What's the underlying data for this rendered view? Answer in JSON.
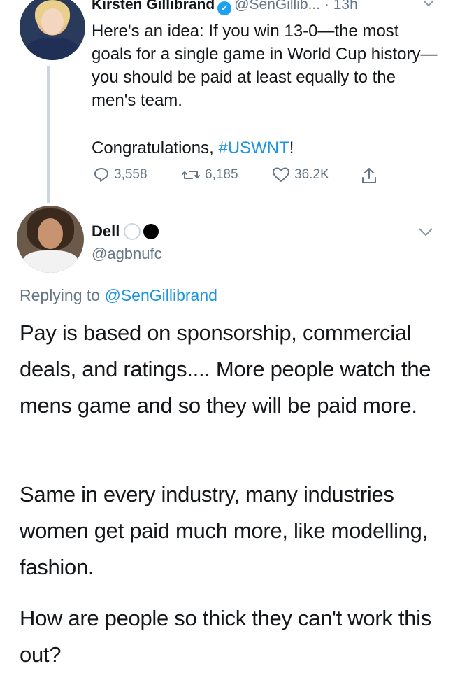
{
  "tweet1": {
    "name": "Kirsten Gillibrand",
    "handle_time": "@SenGillib... · 13h",
    "text": "Here's an idea: If you win 13-0—the most goals for a single game in World Cup history—you should be paid at least equally to the men's team.",
    "congrats_prefix": "Congratulations, ",
    "hashtag": "#USWNT",
    "congrats_suffix": "!",
    "replies": "3,558",
    "retweets": "6,185",
    "likes": "36.2K"
  },
  "tweet2": {
    "name": "Dell",
    "handle": "@agbnufc",
    "replying_prefix": "Replying to ",
    "replying_to": "@SenGillibrand",
    "paragraphs": [
      "Pay is based on sponsorship, commercial deals, and ratings.... More people watch the mens game and so they will be paid more.",
      "Same in every industry, many industries women get paid much more, like modelling, fashion.",
      "How are people so thick they can't work this out?"
    ]
  },
  "colors": {
    "link": "#1b95e0",
    "muted": "#657786",
    "verified": "#1da1f2"
  }
}
